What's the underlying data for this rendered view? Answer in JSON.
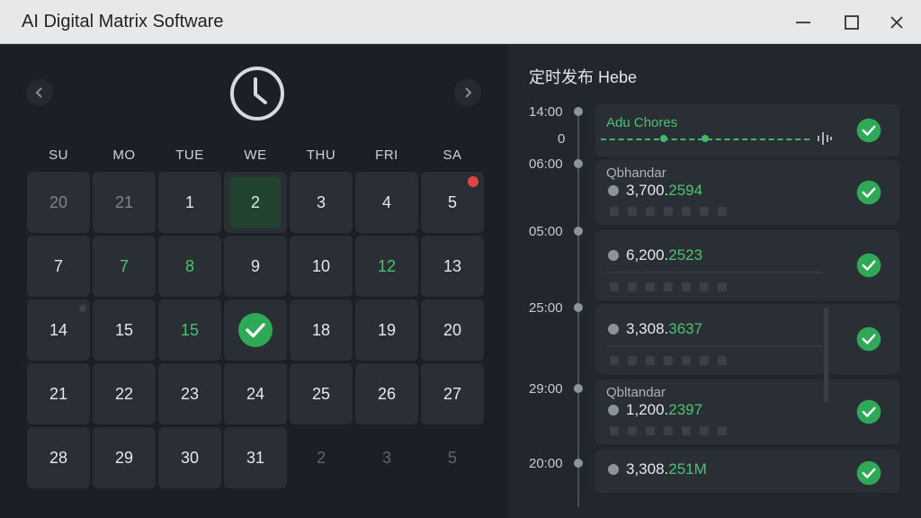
{
  "window": {
    "title": "AI Digital Matrix Software"
  },
  "calendar": {
    "weekdays": [
      "SU",
      "MO",
      "TUE",
      "WE",
      "THU",
      "FRI",
      "SA"
    ],
    "weeks": [
      [
        {
          "d": "20",
          "s": "muted"
        },
        {
          "d": "21",
          "s": "muted"
        },
        {
          "d": "1",
          "s": ""
        },
        {
          "d": "2",
          "s": "selected"
        },
        {
          "d": "3",
          "s": ""
        },
        {
          "d": "4",
          "s": ""
        },
        {
          "d": "5",
          "s": "event"
        }
      ],
      [
        {
          "d": "7",
          "s": ""
        },
        {
          "d": "7",
          "s": "green"
        },
        {
          "d": "8",
          "s": "green"
        },
        {
          "d": "9",
          "s": ""
        },
        {
          "d": "10",
          "s": ""
        },
        {
          "d": "12",
          "s": "green"
        },
        {
          "d": "13",
          "s": ""
        }
      ],
      [
        {
          "d": "14",
          "s": "dot"
        },
        {
          "d": "15",
          "s": ""
        },
        {
          "d": "15",
          "s": "green"
        },
        {
          "d": "",
          "s": "done"
        },
        {
          "d": "18",
          "s": ""
        },
        {
          "d": "19",
          "s": ""
        },
        {
          "d": "20",
          "s": ""
        }
      ],
      [
        {
          "d": "21",
          "s": ""
        },
        {
          "d": "22",
          "s": ""
        },
        {
          "d": "23",
          "s": ""
        },
        {
          "d": "24",
          "s": ""
        },
        {
          "d": "25",
          "s": ""
        },
        {
          "d": "26",
          "s": ""
        },
        {
          "d": "27",
          "s": ""
        }
      ],
      [
        {
          "d": "28",
          "s": ""
        },
        {
          "d": "29",
          "s": ""
        },
        {
          "d": "30",
          "s": ""
        },
        {
          "d": "31",
          "s": ""
        },
        {
          "d": "2",
          "s": "faded"
        },
        {
          "d": "3",
          "s": "faded"
        },
        {
          "d": "5",
          "s": "faded"
        }
      ]
    ]
  },
  "schedule": {
    "title": "定时发布 Hebe",
    "times": [
      "14:00",
      "0",
      "06:00",
      "05:00",
      "25:00",
      "29:00",
      "20:00"
    ],
    "cards": [
      {
        "label": "Adu Chores",
        "value_main": "",
        "value_tail": ""
      },
      {
        "label": "Qbhandar",
        "value_main": "3,700.",
        "value_tail": "2594"
      },
      {
        "label": "",
        "value_main": "6,200.",
        "value_tail": "2523"
      },
      {
        "label": "",
        "value_main": "3,308.",
        "value_tail": "3637"
      },
      {
        "label": "Qbltandar",
        "value_main": "1,200.",
        "value_tail": "2397"
      },
      {
        "label": "",
        "value_main": "3,308.",
        "value_tail": "251M"
      }
    ]
  },
  "colors": {
    "accent": "#43b866",
    "alert": "#e04444"
  }
}
